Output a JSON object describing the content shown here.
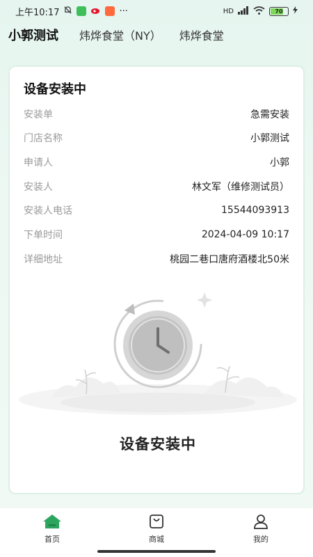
{
  "status_bar": {
    "time": "上午10:17",
    "battery": "70",
    "network": "HD",
    "more": "···"
  },
  "store_tabs": [
    {
      "label": "小郭测试",
      "active": true
    },
    {
      "label": "炜烨食堂（NY）",
      "active": false
    },
    {
      "label": "炜烨食堂",
      "active": false
    }
  ],
  "card": {
    "title": "设备安装中",
    "rows": [
      {
        "label": "安装单",
        "value": "急需安装"
      },
      {
        "label": "门店名称",
        "value": "小郭测试"
      },
      {
        "label": "申请人",
        "value": "小郭"
      },
      {
        "label": "安装人",
        "value": "林文军（维修测试员）"
      },
      {
        "label": "安装人电话",
        "value": "15544093913"
      },
      {
        "label": "下单时间",
        "value": "2024-04-09 10:17"
      },
      {
        "label": "详细地址",
        "value": "桃园二巷口唐府酒楼北50米"
      }
    ],
    "status_text": "设备安装中"
  },
  "bottom_nav": [
    {
      "label": "首页",
      "icon": "home-icon",
      "active": true
    },
    {
      "label": "商城",
      "icon": "shopping-bag-icon",
      "active": false
    },
    {
      "label": "我的",
      "icon": "user-icon",
      "active": false
    }
  ],
  "colors": {
    "accent": "#2ea55f",
    "background": "#e9f6f0",
    "label": "#9a9a9a"
  }
}
